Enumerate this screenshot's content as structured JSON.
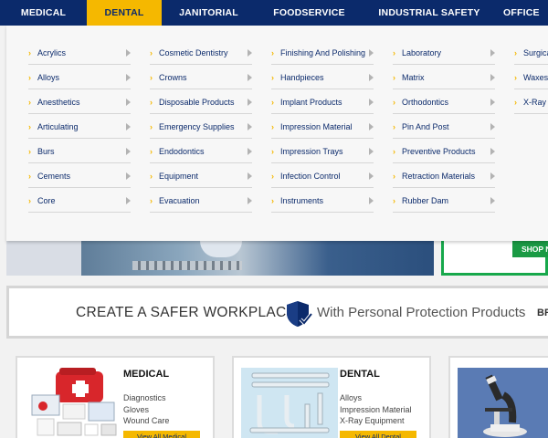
{
  "nav": {
    "tabs": [
      {
        "label": "MEDICAL"
      },
      {
        "label": "DENTAL"
      },
      {
        "label": "JANITORIAL"
      },
      {
        "label": "FOODSERVICE"
      },
      {
        "label": "INDUSTRIAL SAFETY"
      },
      {
        "label": "OFFICE"
      }
    ],
    "active_tab": "DENTAL",
    "accent_color": "#f5b800",
    "nav_color": "#0b2a6b"
  },
  "menu": {
    "bullet": "›",
    "columns": [
      [
        "Acrylics",
        "Alloys",
        "Anesthetics",
        "Articulating",
        "Burs",
        "Cements",
        "Core"
      ],
      [
        "Cosmetic Dentistry",
        "Crowns",
        "Disposable Products",
        "Emergency Supplies",
        "Endodontics",
        "Equipment",
        "Evacuation"
      ],
      [
        "Finishing And Polishing",
        "Handpieces",
        "Implant Products",
        "Impression Material",
        "Impression Trays",
        "Infection Control",
        "Instruments"
      ],
      [
        "Laboratory",
        "Matrix",
        "Orthodontics",
        "Pin And Post",
        "Preventive Products",
        "Retraction Materials",
        "Rubber Dam"
      ],
      [
        "Surgical",
        "Waxes",
        "X-Ray"
      ]
    ]
  },
  "promo": {
    "shop_button": "SHOP N"
  },
  "banner": {
    "left_text": "CREATE A SAFER WORKPLACE",
    "right_text": "With Personal Protection Products",
    "cut_text": "BR"
  },
  "cards": [
    {
      "title": "MEDICAL",
      "items": [
        "Diagnostics",
        "Gloves",
        "Wound Care"
      ],
      "button": "View All Medical"
    },
    {
      "title": "DENTAL",
      "items": [
        "Alloys",
        "Impression Material",
        "X-Ray Equipment"
      ],
      "button": "View All Dental"
    }
  ]
}
